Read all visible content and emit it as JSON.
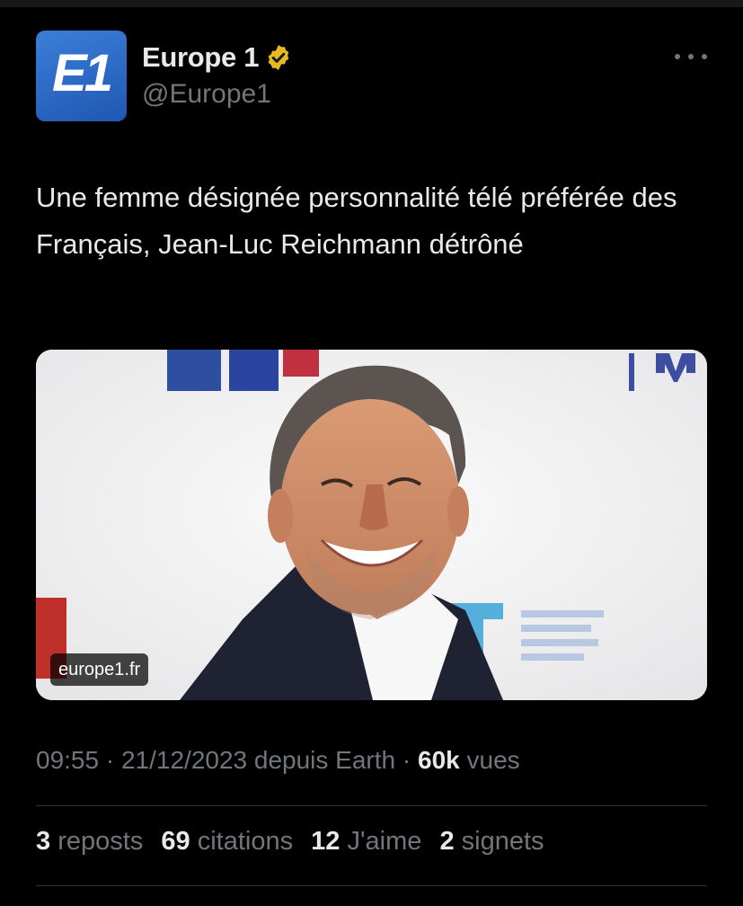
{
  "author": {
    "display_name": "Europe 1",
    "handle": "@Europe1",
    "avatar_text": "E1",
    "avatar_color": "#2f6fc9",
    "verified": true,
    "verified_color": "#e8b923"
  },
  "tweet": {
    "text": "Une femme désignée personnalité télé préférée des Français, Jean-Luc Reichmann détrôné",
    "media": {
      "source_label": "europe1.fr"
    }
  },
  "meta": {
    "time": "09:55",
    "sep1": "·",
    "date": "21/12/2023",
    "via": "depuis Earth",
    "sep2": "·",
    "views_count": "60k",
    "views_label": "vues"
  },
  "stats": {
    "reposts_count": "3",
    "reposts_label": "reposts",
    "quotes_count": "69",
    "quotes_label": "citations",
    "likes_count": "12",
    "likes_label": "J'aime",
    "bookmarks_count": "2",
    "bookmarks_label": "signets"
  },
  "colors": {
    "background": "#000000",
    "text_primary": "#e7e9ea",
    "text_secondary": "#71767b",
    "divider": "#2f3336"
  }
}
